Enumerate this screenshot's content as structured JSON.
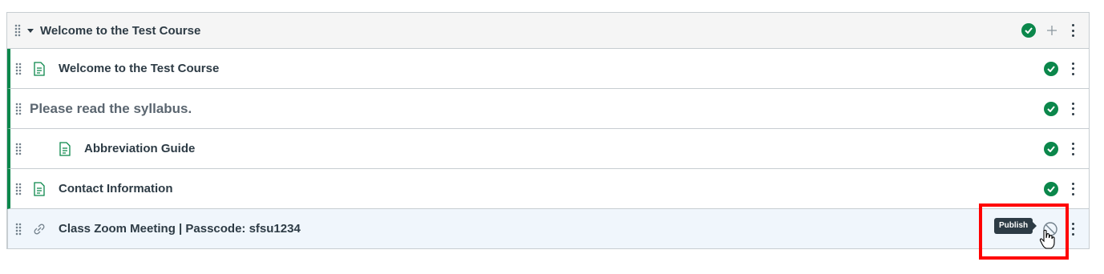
{
  "module": {
    "title": "Welcome to the Test Course",
    "status": "published"
  },
  "items": [
    {
      "type": "page",
      "title": "Welcome to the Test Course",
      "status": "published",
      "icon": "document-icon"
    },
    {
      "type": "subheader",
      "title": "Please read the syllabus.",
      "status": "published"
    },
    {
      "type": "page",
      "title": "Abbreviation Guide",
      "status": "published",
      "icon": "document-icon"
    },
    {
      "type": "page",
      "title": "Contact Information",
      "status": "published",
      "icon": "document-icon"
    },
    {
      "type": "link",
      "title": "Class Zoom Meeting | Passcode: sfsu1234",
      "status": "unpublished",
      "icon": "link-icon"
    }
  ],
  "tooltip": {
    "label": "Publish"
  },
  "colors": {
    "published": "#0b874b",
    "highlight": "#ff0000",
    "text": "#2d3b45"
  }
}
